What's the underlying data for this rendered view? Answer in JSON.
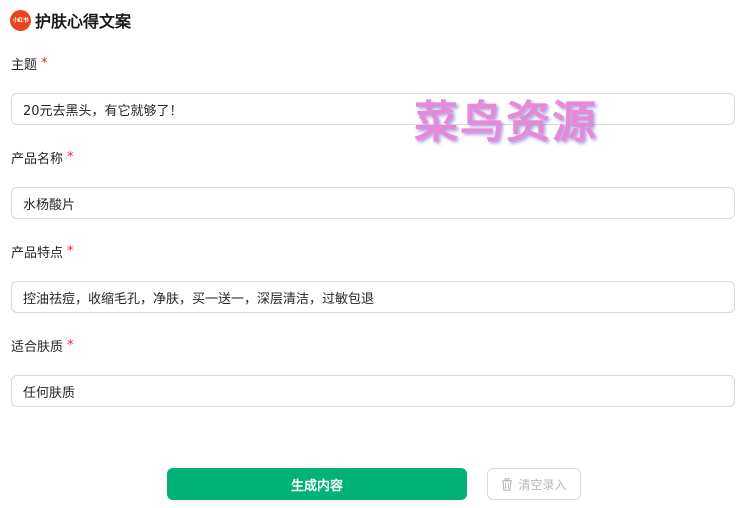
{
  "header": {
    "logo_text": "小红书",
    "title": "护肤心得文案"
  },
  "form": {
    "required_mark": "*",
    "fields": [
      {
        "label": "主题",
        "value": "20元去黑头，有它就够了！"
      },
      {
        "label": "产品名称",
        "value": "水杨酸片"
      },
      {
        "label": "产品特点",
        "value": "控油祛痘，收缩毛孔，净肤，买一送一，深层清洁，过敏包退"
      },
      {
        "label": "适合肤质",
        "value": "任何肤质"
      }
    ]
  },
  "watermark": "菜鸟资源",
  "actions": {
    "generate_label": "生成内容",
    "clear_label": "清空录入",
    "clear_icon": "trash-icon"
  },
  "colors": {
    "primary": "#00b276",
    "required": "#f5222d",
    "logo_bg": "#e8431d",
    "watermark": "#e58ad6"
  }
}
